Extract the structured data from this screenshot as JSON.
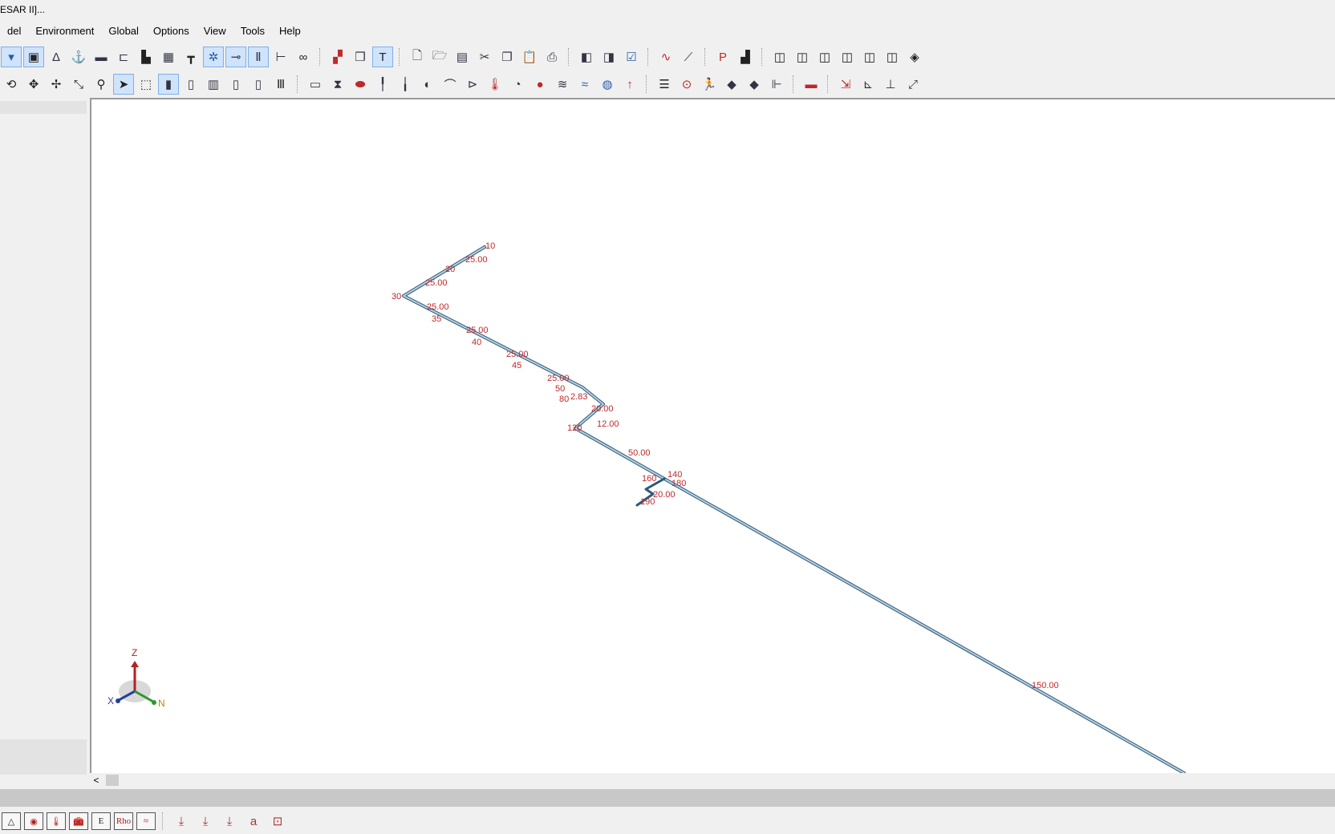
{
  "window": {
    "title": "ESAR II]..."
  },
  "menu": {
    "items": [
      "del",
      "Environment",
      "Global",
      "Options",
      "View",
      "Tools",
      "Help"
    ]
  },
  "toolbar_row1": {
    "groups": [
      [
        "dropdown-icon",
        "screen-icon",
        "delta-icon",
        "anchor-icon",
        "restraint-icon",
        "hanger-icon",
        "support-icon",
        "grid-icon",
        "tee-icon",
        "axes-icon",
        "node-toggle-icon",
        "vertical-scale-icon",
        "elbow-icon",
        "binoculars-icon"
      ],
      [
        "plot-icon",
        "cube-open-icon",
        "text-icon"
      ],
      [
        "new-file-icon",
        "open-folder-icon",
        "save-icon",
        "cut-icon",
        "copy-icon",
        "paste-icon",
        "print-icon"
      ],
      [
        "view-left-icon",
        "view-right-icon",
        "check-icon"
      ],
      [
        "waveform-icon",
        "graph-icon"
      ],
      [
        "plt-icon",
        "render-icon"
      ],
      [
        "iso-view-1-icon",
        "iso-view-2-icon",
        "iso-view-3-icon",
        "iso-view-4-icon",
        "iso-view-5-icon",
        "iso-view-6-icon",
        "view-cube-icon"
      ]
    ]
  },
  "toolbar_row2": {
    "groups": [
      [
        "rotate-icon",
        "pan-icon",
        "move-icon",
        "zoom-icon",
        "walk-icon",
        "select-icon",
        "select-box-icon",
        "solid-pipe-icon",
        "wire-pipe-icon",
        "line-pipe-icon",
        "center-line-icon",
        "single-line-icon",
        "bars-icon"
      ],
      [
        "flange-icon",
        "valve-icon",
        "expansion-joint-icon",
        "restraint-node-icon",
        "hanger-node-icon",
        "nozzle-icon",
        "bend-icon",
        "reducer-icon",
        "thermometer-icon",
        "pressure-gauge-icon",
        "material-icon",
        "wind-icon",
        "wave-icon",
        "seismic-icon",
        "force-icon"
      ],
      [
        "list-icon",
        "record-icon",
        "run-icon",
        "load-1-icon",
        "load-2-icon",
        "axis-arrows-icon"
      ],
      [
        "ruler-icon"
      ],
      [
        "measure-icon",
        "dims-1-icon",
        "dims-2-icon",
        "dims-3-icon"
      ]
    ]
  },
  "model": {
    "node_labels": [
      "10",
      "20",
      "30",
      "35",
      "40",
      "45",
      "50",
      "80",
      "120",
      "140",
      "160",
      "180",
      "190"
    ],
    "length_labels": [
      "25.00",
      "25.00",
      "25.00",
      "25.00",
      "25.00",
      "25.00",
      "2.83",
      "20.00",
      "12.00",
      "50.00",
      "20.00",
      "150.00"
    ]
  },
  "axes": {
    "z": "Z",
    "x": "X",
    "n": "N"
  },
  "scrollbar": {
    "left_arrow": "<"
  },
  "bottom_toolbar": {
    "buttons": [
      "△",
      "◉",
      "🌡",
      "🧰",
      "E",
      "Rho",
      "≈"
    ],
    "tools": [
      "cursor-1-icon",
      "cursor-2-icon",
      "cursor-3-icon",
      "a1-icon",
      "zoom-window-icon"
    ]
  },
  "colors": {
    "pipe": "#9fb6c8",
    "pipe_edge": "#2c5a7a",
    "label": "#c0282a"
  }
}
